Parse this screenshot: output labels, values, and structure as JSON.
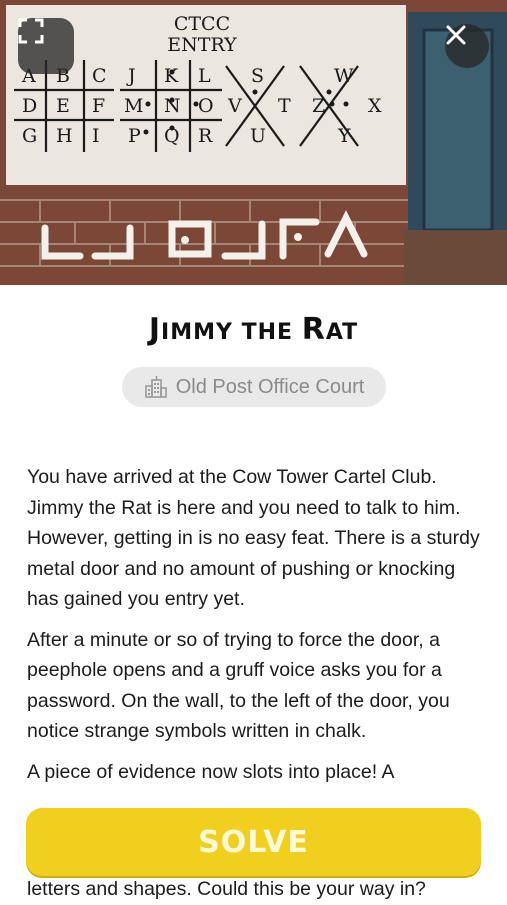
{
  "hero": {
    "sign_title_line1": "CTCC",
    "sign_title_line2": "ENTRY",
    "grid1": [
      [
        "A",
        "B",
        "C"
      ],
      [
        "D",
        "E",
        "F"
      ],
      [
        "G",
        "H",
        "I"
      ]
    ],
    "grid2": [
      [
        "J",
        "K",
        "L"
      ],
      [
        "M",
        "N",
        "O"
      ],
      [
        "P",
        "Q",
        "R"
      ]
    ],
    "x1": {
      "top": "S",
      "left": "V",
      "right": "T",
      "bottom": "U"
    },
    "x2": {
      "top": "W",
      "left": "Z",
      "right": "X",
      "bottom": "Y"
    },
    "fullscreen_icon": "fullscreen-icon",
    "close_icon": "close-icon"
  },
  "title": {
    "first": "J",
    "first_rest": "IMMY THE ",
    "last": "R",
    "last_rest": "AT"
  },
  "location": {
    "icon": "building-icon",
    "label": "Old Post Office Court"
  },
  "paragraphs": [
    "You have arrived at the Cow Tower Cartel Club. Jimmy the Rat is here and you need to talk to him. However, getting in is no easy feat. There is a sturdy metal door and no amount of pushing or knocking has gained you entry yet.",
    "After a minute or so of trying to force the door, a peephole opens and a gruff voice asks you for a password. On the wall, to the left of the door, you notice strange symbols written in chalk.",
    "A piece of evidence now slots into place! A",
    "letters and shapes. Could this be your way in?"
  ],
  "solve_button": {
    "label": "SOLVE"
  },
  "colors": {
    "accent": "#f0cf1e",
    "pill_bg": "#e9e9e9"
  }
}
